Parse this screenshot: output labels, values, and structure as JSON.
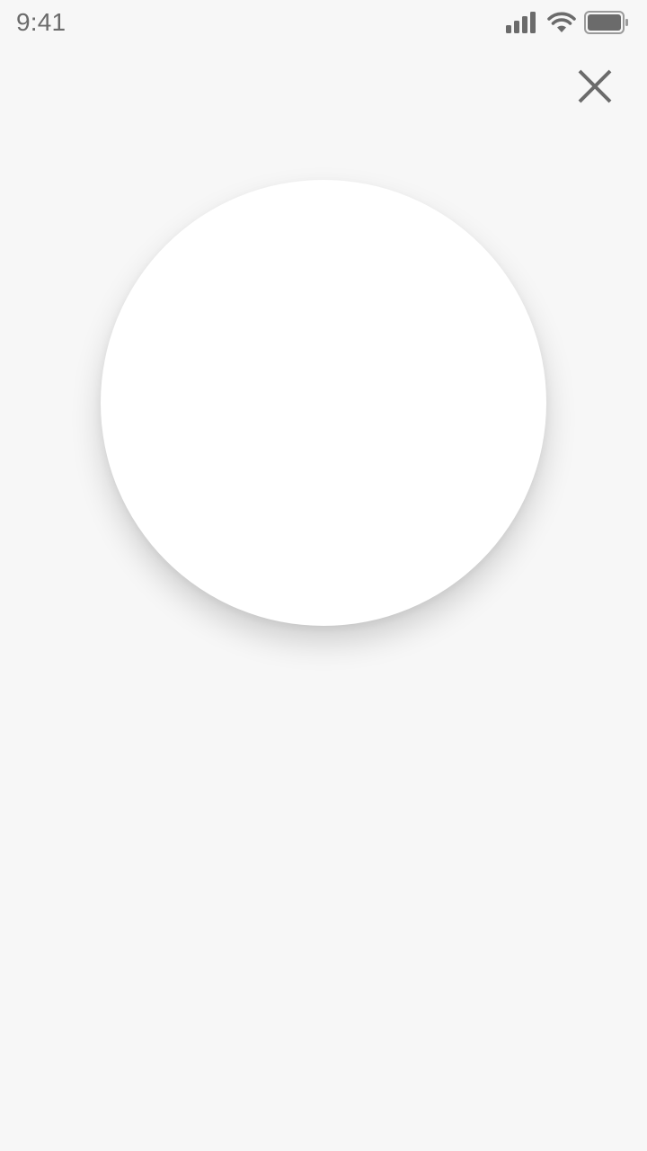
{
  "status_bar": {
    "time": "9:41",
    "icons": [
      "signal-icon",
      "wifi-icon",
      "battery-icon"
    ]
  },
  "close_button": {
    "icon": "close-icon"
  },
  "colors": {
    "background": "#f7f7f7",
    "icon": "#6b6b6b",
    "circle": "#ffffff"
  }
}
